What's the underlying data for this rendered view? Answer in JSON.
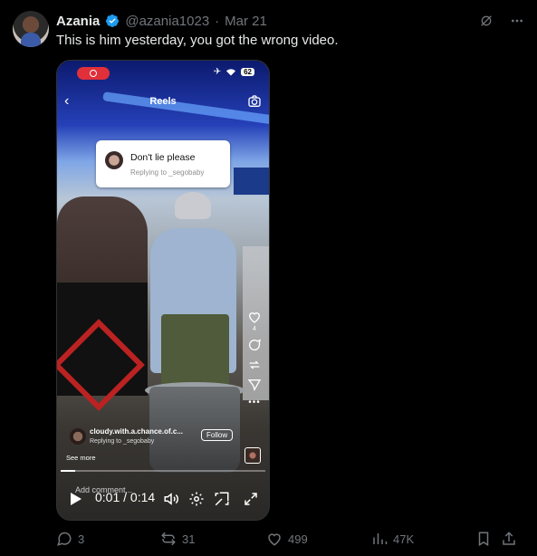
{
  "tweet": {
    "author_name": "Azania",
    "handle": "@azania1023",
    "separator": "·",
    "date": "Mar 21",
    "text": "This is him yesterday, you got the wrong video."
  },
  "video": {
    "reels_title": "Reels",
    "battery": "62",
    "reply_card": {
      "text": "Don't lie please",
      "sub": "Replying to _segobaby"
    },
    "side_like_count": "4",
    "caption_user": "cloudy.with.a.chance.of.c...",
    "caption_reply": "Replying to _segobaby",
    "follow_label": "Follow",
    "see_more": "See more",
    "add_comment": "Add comment...",
    "time_display": "0:01 / 0:14",
    "progress": 0.07
  },
  "actions": {
    "replies": "3",
    "reposts": "31",
    "likes": "499",
    "views": "47K"
  },
  "colors": {
    "accent": "#1d9bf0",
    "muted": "#71767b",
    "text": "#e7e9ea"
  }
}
